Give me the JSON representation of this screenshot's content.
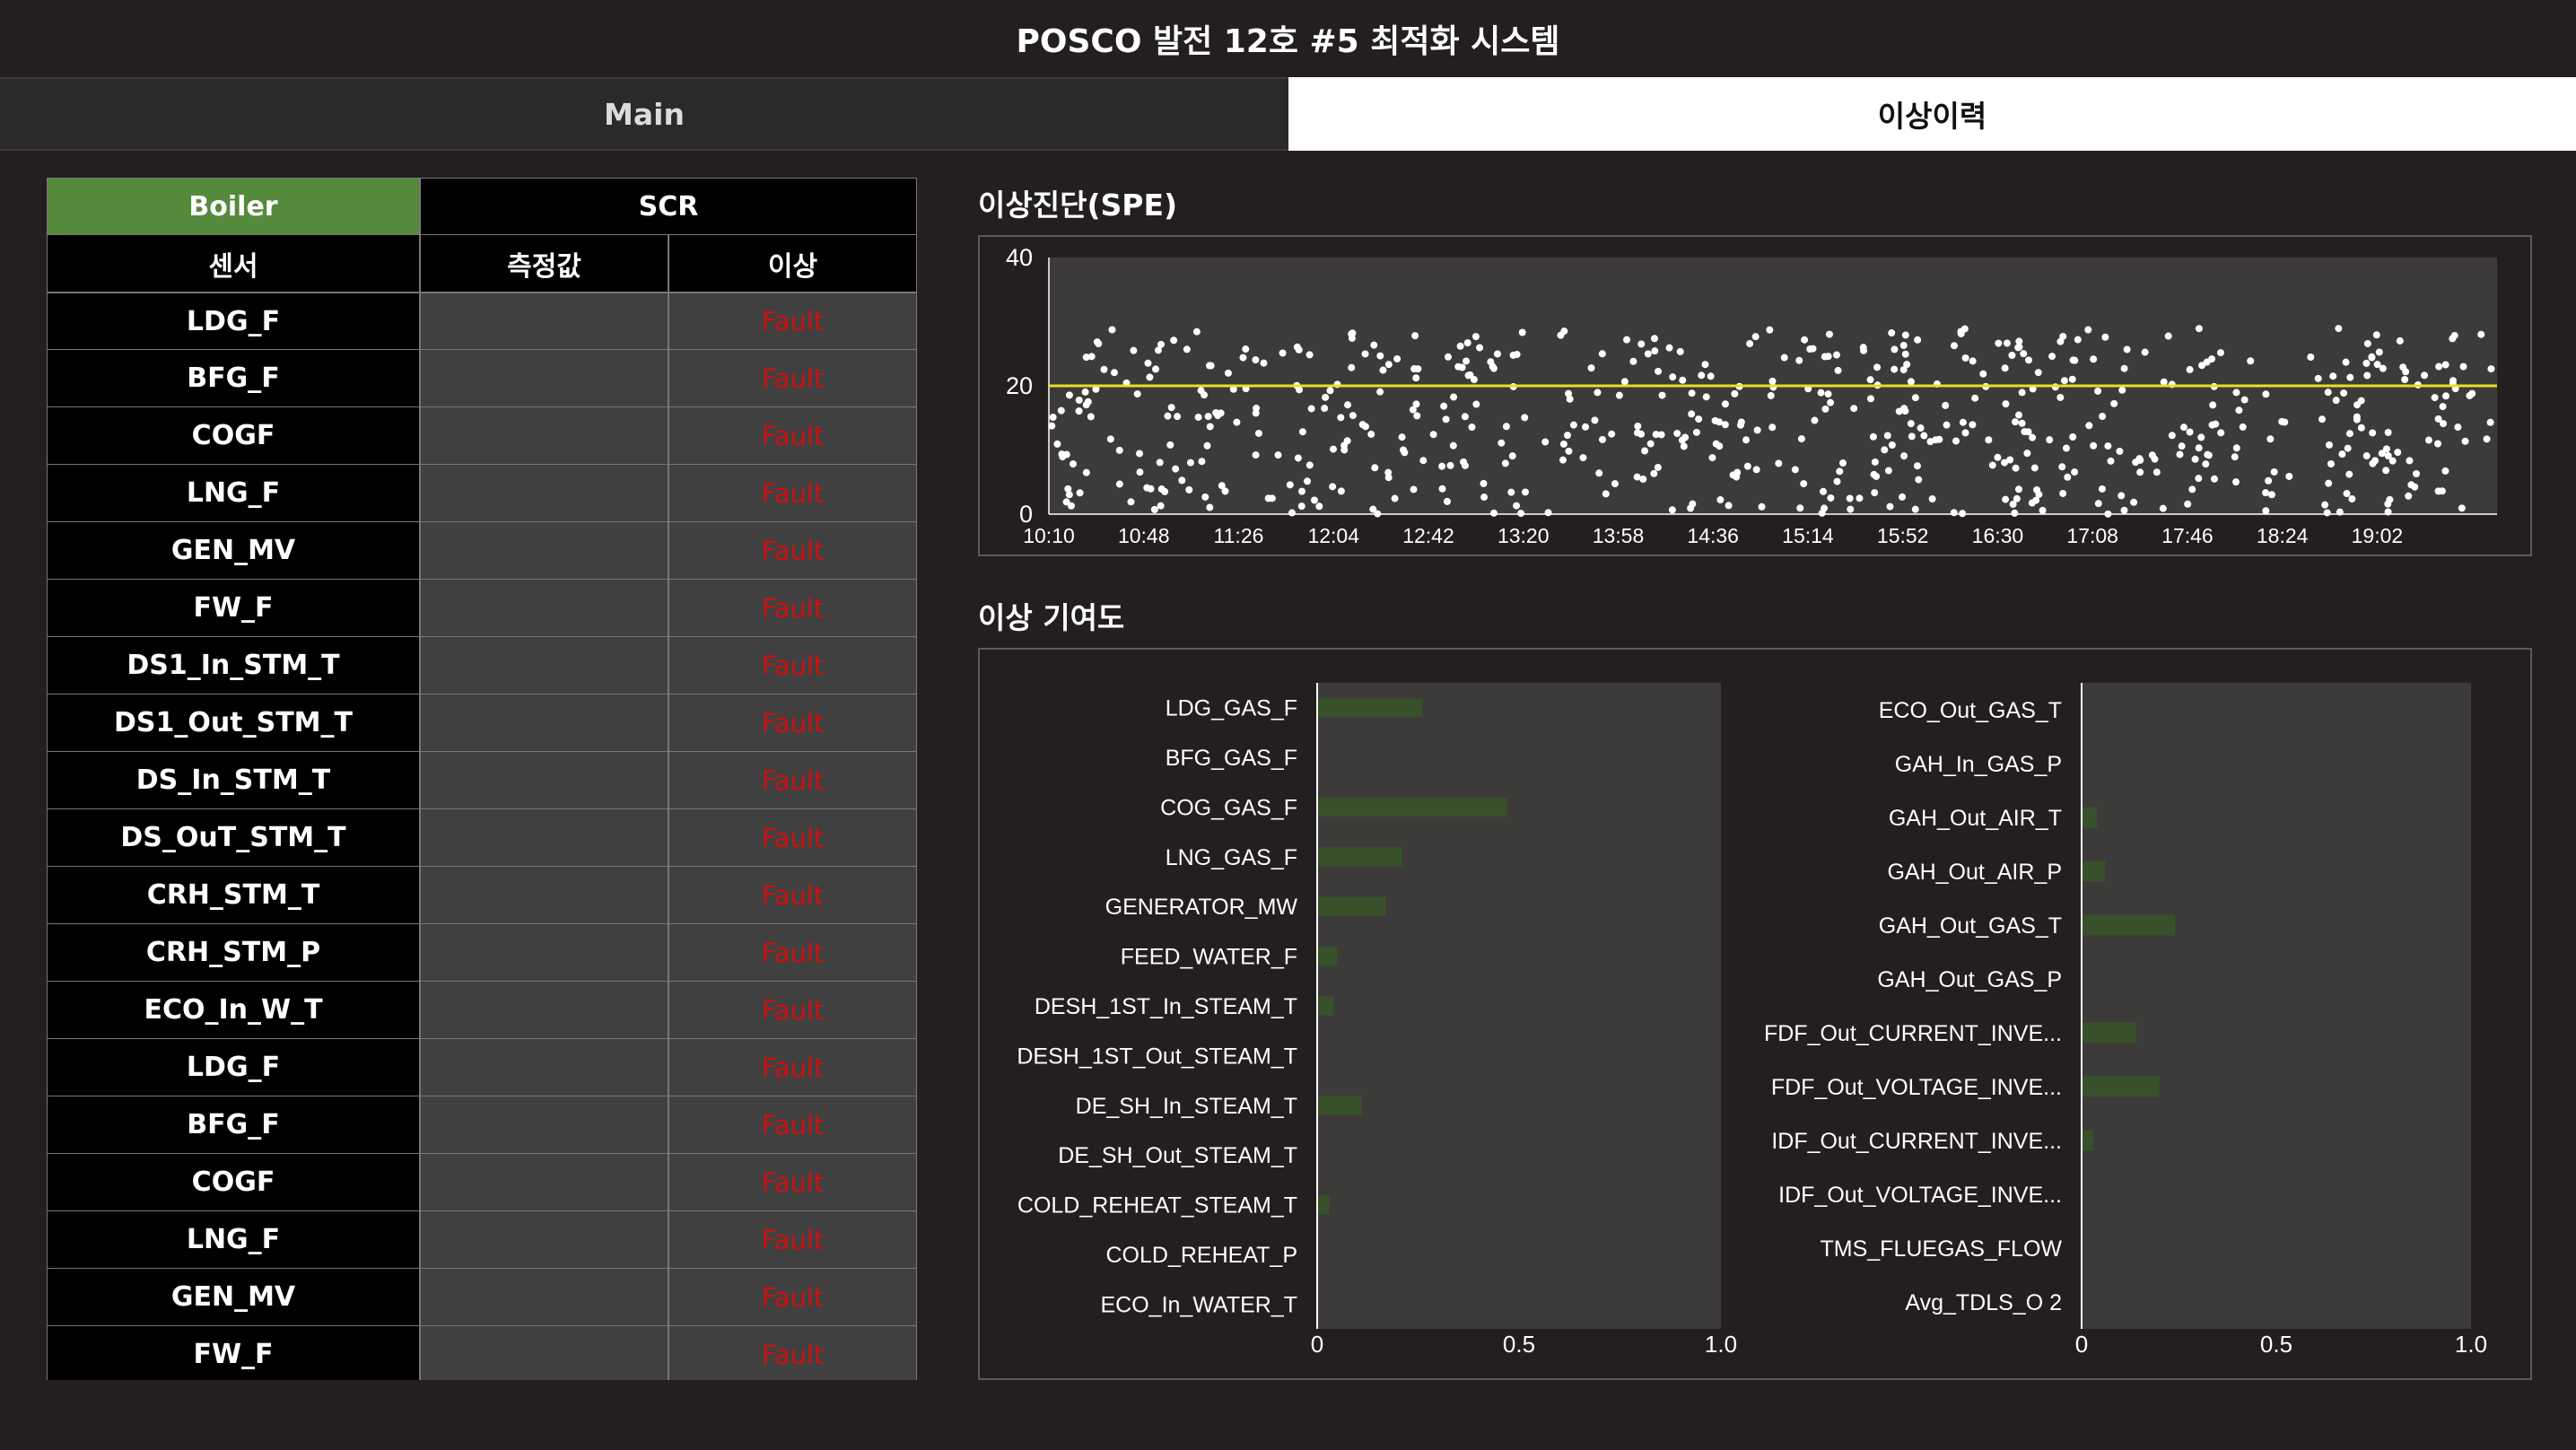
{
  "app": {
    "title": "POSCO 발전 12호 #5 최적화 시스템"
  },
  "tabs": [
    {
      "label": "Main"
    },
    {
      "label": "이상이력"
    }
  ],
  "sensor_table": {
    "groups": {
      "boiler": "Boiler",
      "scr": "SCR"
    },
    "columns": {
      "sensor": "센서",
      "measured": "측정값",
      "anomaly": "이상"
    },
    "rows": [
      {
        "sensor": "LDG_F",
        "value": "",
        "status": "Fault"
      },
      {
        "sensor": "BFG_F",
        "value": "",
        "status": "Fault"
      },
      {
        "sensor": "COGF",
        "value": "",
        "status": "Fault"
      },
      {
        "sensor": "LNG_F",
        "value": "",
        "status": "Fault"
      },
      {
        "sensor": "GEN_MV",
        "value": "",
        "status": "Fault"
      },
      {
        "sensor": "FW_F",
        "value": "",
        "status": "Fault"
      },
      {
        "sensor": "DS1_In_STM_T",
        "value": "",
        "status": "Fault"
      },
      {
        "sensor": "DS1_Out_STM_T",
        "value": "",
        "status": "Fault"
      },
      {
        "sensor": "DS_In_STM_T",
        "value": "",
        "status": "Fault"
      },
      {
        "sensor": "DS_OuT_STM_T",
        "value": "",
        "status": "Fault"
      },
      {
        "sensor": "CRH_STM_T",
        "value": "",
        "status": "Fault"
      },
      {
        "sensor": "CRH_STM_P",
        "value": "",
        "status": "Fault"
      },
      {
        "sensor": "ECO_In_W_T",
        "value": "",
        "status": "Fault"
      },
      {
        "sensor": "LDG_F",
        "value": "",
        "status": "Fault"
      },
      {
        "sensor": "BFG_F",
        "value": "",
        "status": "Fault"
      },
      {
        "sensor": "COGF",
        "value": "",
        "status": "Fault"
      },
      {
        "sensor": "LNG_F",
        "value": "",
        "status": "Fault"
      },
      {
        "sensor": "GEN_MV",
        "value": "",
        "status": "Fault"
      },
      {
        "sensor": "FW_F",
        "value": "",
        "status": "Fault"
      }
    ],
    "colors": {
      "boiler_active": "#55893c",
      "fault_text": "#cc1010"
    }
  },
  "spe_section": {
    "title": "이상진단(SPE)"
  },
  "contribution_section": {
    "title": "이상 기여도"
  },
  "chart_data": [
    {
      "type": "scatter",
      "y_ticks": [
        0,
        20,
        40
      ],
      "ylim": [
        0,
        40
      ],
      "x_ticks": [
        "10:10",
        "10:48",
        "11:26",
        "12:04",
        "12:42",
        "13:20",
        "13:58",
        "14:36",
        "15:14",
        "15:52",
        "16:30",
        "17:08",
        "17:46",
        "18:24",
        "19:02"
      ],
      "x_start": "10:10",
      "x_end": "19:50",
      "threshold": 20,
      "n_points": 600,
      "points_range": [
        0,
        29
      ],
      "point_color": "#ffffff",
      "threshold_color": "#e8e020",
      "plot_background": "#3c3b3a"
    },
    {
      "type": "bar",
      "orientation": "horizontal",
      "categories": [
        "LDG_GAS_F",
        "BFG_GAS_F",
        "COG_GAS_F",
        "LNG_GAS_F",
        "GENERATOR_MW",
        "FEED_WATER_F",
        "DESH_1ST_In_STEAM_T",
        "DESH_1ST_Out_STEAM_T",
        "DE_SH_In_STEAM_T",
        "DE_SH_Out_STEAM_T",
        "COLD_REHEAT_STEAM_T",
        "COLD_REHEAT_P",
        "ECO_In_WATER_T"
      ],
      "values": [
        0.26,
        0.0,
        0.47,
        0.21,
        0.17,
        0.05,
        0.04,
        0.0,
        0.11,
        0.0,
        0.03,
        0.0,
        0.0
      ],
      "xlim": [
        0,
        1.0
      ],
      "x_ticks": [
        "0",
        "0.5",
        "1.0"
      ],
      "bar_color": "#38512a",
      "plot_background": "#3c3b3a"
    },
    {
      "type": "bar",
      "orientation": "horizontal",
      "categories": [
        "ECO_Out_GAS_T",
        "GAH_In_GAS_P",
        "GAH_Out_AIR_T",
        "GAH_Out_AIR_P",
        "GAH_Out_GAS_T",
        "GAH_Out_GAS_P",
        "FDF_Out_CURRENT_INVE...",
        "FDF_Out_VOLTAGE_INVE...",
        "IDF_Out_CURRENT_INVE...",
        "IDF_Out_VOLTAGE_INVE...",
        "TMS_FLUEGAS_FLOW",
        "Avg_TDLS_O 2"
      ],
      "values": [
        0.0,
        0.0,
        0.04,
        0.06,
        0.24,
        0.0,
        0.14,
        0.2,
        0.03,
        0.0,
        0.0,
        0.0
      ],
      "xlim": [
        0,
        1.0
      ],
      "x_ticks": [
        "0",
        "0.5",
        "1.0"
      ],
      "bar_color": "#38512a",
      "plot_background": "#3c3b3a"
    }
  ]
}
